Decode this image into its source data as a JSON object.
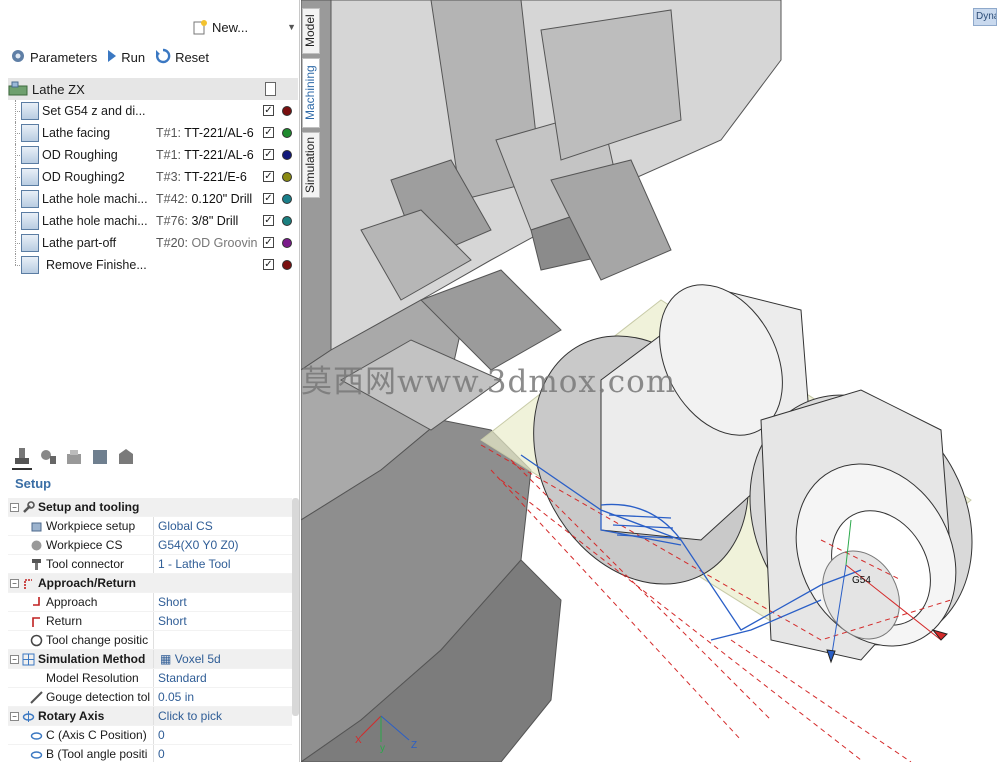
{
  "toolbar": {
    "new_label": "New...",
    "parameters_label": "Parameters",
    "run_label": "Run",
    "reset_label": "Reset"
  },
  "tree": {
    "root_label": "Lathe ZX",
    "operations": [
      {
        "name": "Set G54 z and di...",
        "tool_num": "",
        "tool_name": "",
        "dot_color": "#7a1010"
      },
      {
        "name": "Lathe facing",
        "tool_num": "T#1:",
        "tool_name": "TT-221/AL-6",
        "dot_color": "#1f8a2e"
      },
      {
        "name": "OD Roughing",
        "tool_num": "T#1:",
        "tool_name": "TT-221/AL-6",
        "dot_color": "#12197a"
      },
      {
        "name": "OD Roughing2",
        "tool_num": "T#3:",
        "tool_name": "TT-221/E-6",
        "dot_color": "#8a8a12"
      },
      {
        "name": "Lathe hole machi...",
        "tool_num": "T#42:",
        "tool_name": "0.120\" Drill",
        "dot_color": "#1a7f8a"
      },
      {
        "name": "Lathe hole machi...",
        "tool_num": "T#76:",
        "tool_name": "3/8\" Drill",
        "dot_color": "#1a7f7f"
      },
      {
        "name": "Lathe part-off",
        "tool_num": "T#20:",
        "tool_name": "OD Groovin",
        "dot_color": "#7a1a8a"
      },
      {
        "name": "Remove Finishe...",
        "tool_num": "",
        "tool_name": "",
        "dot_color": "#7a1010"
      }
    ]
  },
  "panel": {
    "title": "Setup"
  },
  "properties": {
    "setup_group": "Setup and tooling",
    "workpiece_setup_label": "Workpiece setup",
    "workpiece_setup_value": "Global CS",
    "workpiece_cs_label": "Workpiece CS",
    "workpiece_cs_value": "G54(X0 Y0 Z0)",
    "tool_connector_label": "Tool connector",
    "tool_connector_value": "1 - Lathe Tool",
    "approach_group": "Approach/Return",
    "approach_label": "Approach",
    "approach_value": "Short",
    "return_label": "Return",
    "return_value": "Short",
    "tool_change_label": "Tool change positic",
    "sim_group": "Simulation Method",
    "sim_value": "Voxel 5d",
    "model_res_label": "Model Resolution",
    "model_res_value": "Standard",
    "gouge_label": "Gouge detection tol",
    "gouge_value": "0.05 in",
    "rotary_group": "Rotary Axis",
    "rotary_value": "Click to pick",
    "c_axis_label": "C (Axis C Position)",
    "c_axis_value": "0",
    "b_axis_label": "B (Tool angle positi",
    "b_axis_value": "0"
  },
  "vtabs": {
    "model": "Model",
    "machining": "Machining",
    "simulation": "Simulation"
  },
  "viewport": {
    "dyn_label": "Dyna",
    "watermark": "莫西网www.3dmox.com",
    "cs_label": "G54",
    "axis_x": "X",
    "axis_y": "y",
    "axis_z": "Z"
  },
  "colors": {
    "accent": "#2f6aa8",
    "value_text": "#2f5d96",
    "toolpath_red": "#d42a2a",
    "toolpath_blue": "#2a5fc7"
  }
}
